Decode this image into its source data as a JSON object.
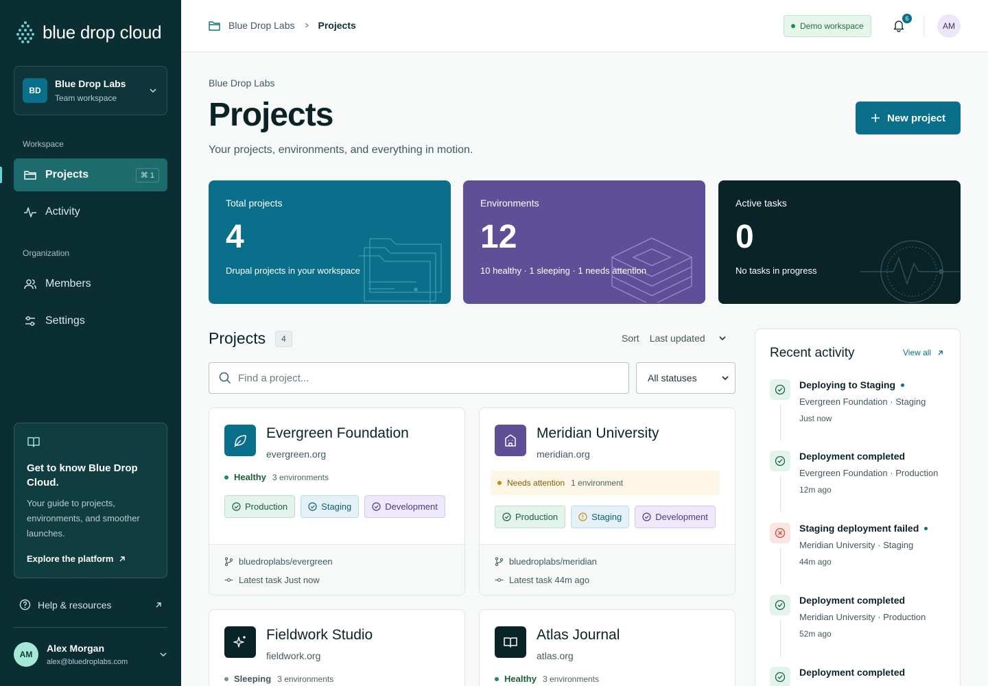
{
  "brand": {
    "name": "blue drop cloud"
  },
  "org": {
    "initials": "BD",
    "name": "Blue Drop Labs",
    "type": "Team workspace"
  },
  "sidebar": {
    "workspace_label": "Workspace",
    "organization_label": "Organization",
    "items": [
      {
        "label": "Projects",
        "shortcut": "⌘ 1",
        "active": true
      },
      {
        "label": "Activity"
      },
      {
        "label": "Members"
      },
      {
        "label": "Settings"
      }
    ],
    "guide": {
      "title": "Get to know Blue Drop Cloud.",
      "description": "Your guide to projects, environments, and smoother launches.",
      "link": "Explore the platform"
    },
    "help": "Help & resources",
    "user": {
      "initials": "AM",
      "name": "Alex Morgan",
      "email": "alex@bluedroplabs.com"
    }
  },
  "topbar": {
    "breadcrumb": [
      "Blue Drop Labs",
      "Projects"
    ],
    "demo_badge": "Demo workspace",
    "notification_count": "6",
    "avatar": "AM"
  },
  "header": {
    "eyebrow": "Blue Drop Labs",
    "title": "Projects",
    "subtitle": "Your projects, environments, and everything in motion.",
    "new_button": "New project"
  },
  "stats": [
    {
      "label": "Total projects",
      "value": "4",
      "desc": "Drupal projects in your workspace",
      "color": "#0a6f8a"
    },
    {
      "label": "Environments",
      "value": "12",
      "desc": "10 healthy · 1 sleeping · 1 needs attention",
      "color": "#5f4f96"
    },
    {
      "label": "Active tasks",
      "value": "0",
      "desc": "No tasks in progress",
      "color": "#0a2327"
    }
  ],
  "projects_section": {
    "title": "Projects",
    "count": "4",
    "sort_label": "Sort",
    "sort_value": "Last updated",
    "search_placeholder": "Find a project...",
    "status_filter": "All statuses"
  },
  "projects": [
    {
      "name": "Evergreen Foundation",
      "domain": "evergreen.org",
      "status": "Healthy",
      "env_count": "3 environments",
      "envs": [
        "Production",
        "Staging",
        "Development"
      ],
      "repo": "bluedroplabs/evergreen",
      "latest_task": "Latest task Just now"
    },
    {
      "name": "Meridian University",
      "domain": "meridian.org",
      "status": "Needs attention",
      "env_count": "1 environment",
      "envs": [
        "Production",
        "Staging",
        "Development"
      ],
      "repo": "bluedroplabs/meridian",
      "latest_task": "Latest task 44m ago"
    },
    {
      "name": "Fieldwork Studio",
      "domain": "fieldwork.org",
      "status": "Sleeping",
      "env_count": "3 environments"
    },
    {
      "name": "Atlas Journal",
      "domain": "atlas.org",
      "status": "Healthy",
      "env_count": "3 environments"
    }
  ],
  "activity": {
    "title": "Recent activity",
    "view_all": "View all",
    "items": [
      {
        "title": "Deploying to Staging",
        "project": "Evergreen Foundation",
        "env": "Staging",
        "time": "Just now",
        "state": "success",
        "live": true
      },
      {
        "title": "Deployment completed",
        "project": "Evergreen Foundation",
        "env": "Production",
        "time": "12m ago",
        "state": "success",
        "live": false
      },
      {
        "title": "Staging deployment failed",
        "project": "Meridian University",
        "env": "Staging",
        "time": "44m ago",
        "state": "error",
        "live": true
      },
      {
        "title": "Deployment completed",
        "project": "Meridian University",
        "env": "Production",
        "time": "52m ago",
        "state": "success",
        "live": false
      },
      {
        "title": "Deployment completed",
        "state": "success",
        "live": false
      }
    ]
  },
  "colors": {
    "accent": "#0a6f8a",
    "sidebar": "#0b2e33",
    "healthy": "#1f8a55",
    "attention": "#c98a10",
    "error": "#d0453b"
  }
}
